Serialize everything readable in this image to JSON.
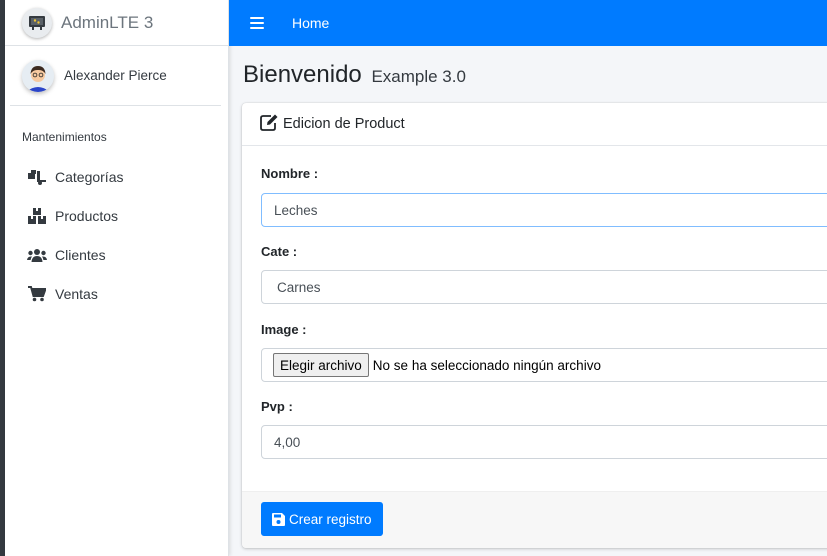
{
  "brand": {
    "name": "AdminLTE 3"
  },
  "user": {
    "name": "Alexander Pierce"
  },
  "sidebar": {
    "header": "Mantenimientos",
    "items": [
      {
        "label": "Categorías",
        "icon": "truck-loading-icon"
      },
      {
        "label": "Productos",
        "icon": "boxes-icon"
      },
      {
        "label": "Clientes",
        "icon": "users-icon"
      },
      {
        "label": "Ventas",
        "icon": "shopping-cart-icon"
      }
    ]
  },
  "navbar": {
    "home_label": "Home"
  },
  "page": {
    "title": "Bienvenido",
    "subtitle": "Example 3.0"
  },
  "card": {
    "title": "Edicion de Product",
    "fields": {
      "nombre": {
        "label": "Nombre :",
        "value": "Leches"
      },
      "cate": {
        "label": "Cate :",
        "value": "Carnes"
      },
      "image": {
        "label": "Image :",
        "button_label": "Elegir archivo",
        "file_status": "No se ha seleccionado ningún archivo"
      },
      "pvp": {
        "label": "Pvp :",
        "value": "4,00"
      }
    },
    "submit_label": "Crear registro"
  },
  "colors": {
    "primary": "#007bff",
    "sidebar_bg": "#ffffff",
    "content_bg": "#f4f6f9"
  }
}
